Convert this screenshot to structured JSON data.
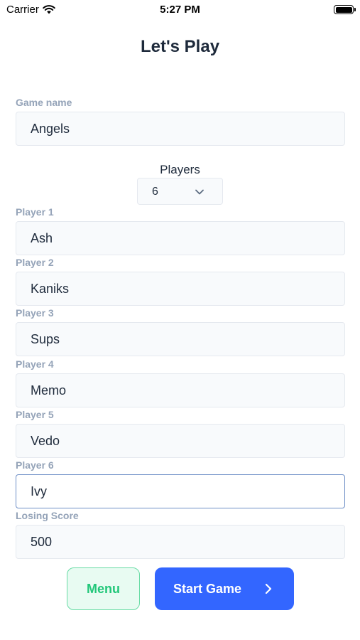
{
  "status_bar": {
    "carrier": "Carrier",
    "time": "5:27 PM"
  },
  "page": {
    "title": "Let's Play"
  },
  "game": {
    "label": "Game name",
    "value": "Angels"
  },
  "players_select": {
    "label": "Players",
    "value": "6"
  },
  "players": [
    {
      "label": "Player 1",
      "value": "Ash"
    },
    {
      "label": "Player 2",
      "value": "Kaniks"
    },
    {
      "label": "Player 3",
      "value": "Sups"
    },
    {
      "label": "Player 4",
      "value": "Memo"
    },
    {
      "label": "Player 5",
      "value": "Vedo"
    },
    {
      "label": "Player 6",
      "value": "Ivy"
    }
  ],
  "losing_score": {
    "label": "Losing Score",
    "value": "500"
  },
  "buttons": {
    "menu": "Menu",
    "start": "Start Game"
  },
  "colors": {
    "accent": "#3366ff",
    "menu_green": "#22c77a",
    "label_gray": "#94a3b8"
  },
  "icons": [
    "wifi-icon",
    "battery-icon",
    "chevron-down-icon",
    "chevron-right-icon"
  ]
}
